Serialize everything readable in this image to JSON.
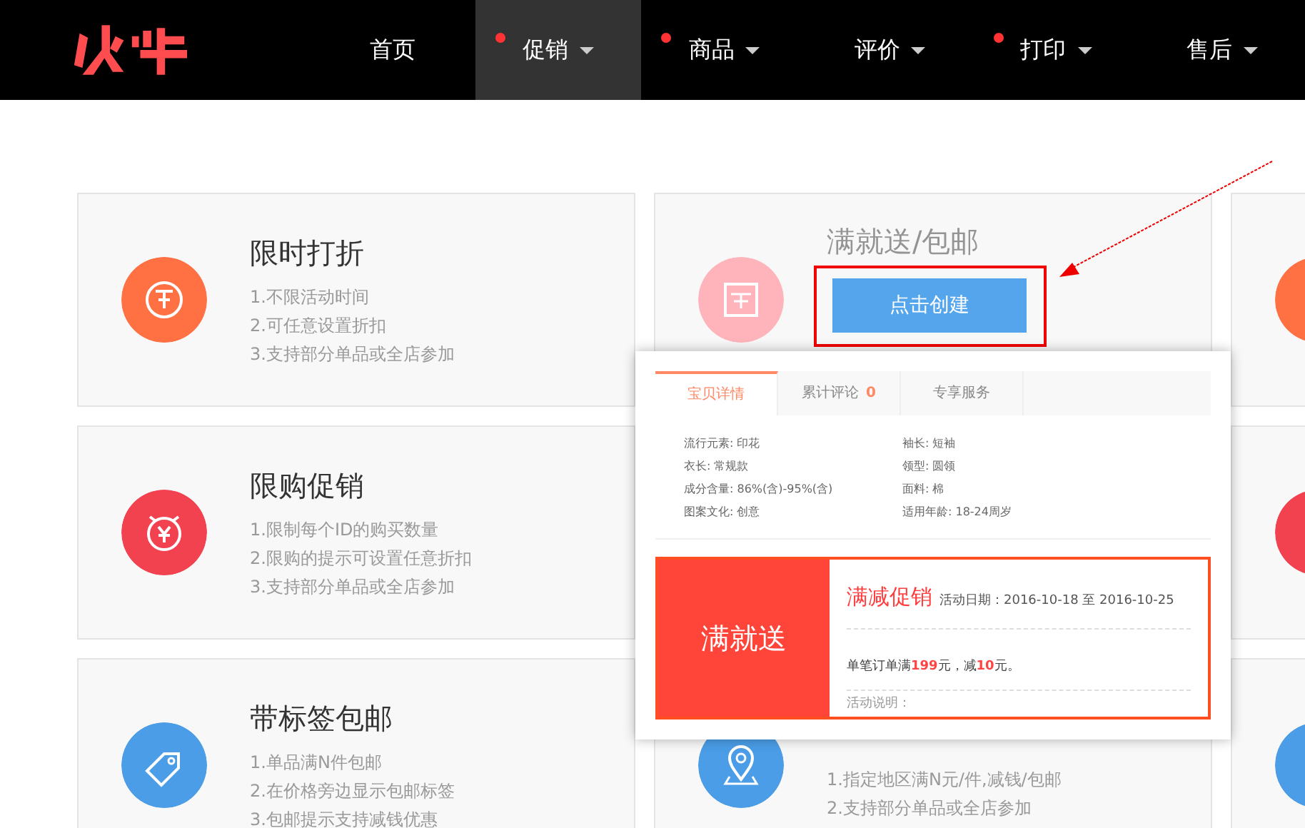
{
  "nav": {
    "items": [
      {
        "label": "首页",
        "selected": false,
        "dot": false,
        "dropdown": false
      },
      {
        "label": "促销",
        "selected": true,
        "dot": true,
        "dropdown": true
      },
      {
        "label": "商品",
        "selected": false,
        "dot": true,
        "dropdown": true
      },
      {
        "label": "评价",
        "selected": false,
        "dot": false,
        "dropdown": true
      },
      {
        "label": "打印",
        "selected": false,
        "dot": true,
        "dropdown": true
      },
      {
        "label": "售后",
        "selected": false,
        "dot": false,
        "dropdown": true
      }
    ]
  },
  "cards": [
    {
      "kind": "discount",
      "color": "#ff7043",
      "title": "限时打折",
      "lines": [
        "1.不限活动时间",
        "2.可任意设置折扣",
        "3.支持部分单品或全店参加"
      ]
    },
    {
      "kind": "full",
      "color": "#ffb3ba",
      "title": "满就送/包邮",
      "button": "点击创建"
    },
    {
      "kind": "edge",
      "color": "#ff7043"
    },
    {
      "kind": "limit",
      "color": "#f2414f",
      "title": "限购促销",
      "lines": [
        "1.限制每个ID的购买数量",
        "2.限购的提示可设置任意折扣",
        "3.支持部分单品或全店参加"
      ]
    },
    {
      "kind": "blank"
    },
    {
      "kind": "edge",
      "color": "#f2414f"
    },
    {
      "kind": "tag",
      "color": "#4a9de6",
      "title": "带标签包邮",
      "lines": [
        "1.单品满N件包邮",
        "2.在价格旁边显示包邮标签",
        "3.包邮提示支持减钱优惠"
      ]
    },
    {
      "kind": "location",
      "color": "#4a9de6",
      "lines": [
        "1.指定地区满N元/件,减钱/包邮",
        "2.支持部分单品或全店参加"
      ]
    },
    {
      "kind": "edge",
      "color": "#4a9de6"
    }
  ],
  "popup": {
    "tabs": [
      {
        "label": "宝贝详情",
        "selected": true
      },
      {
        "label": "累计评论",
        "count": "0",
        "selected": false
      },
      {
        "label": "专享服务",
        "selected": false
      }
    ],
    "specs": [
      "流行元素: 印花",
      "袖长: 短袖",
      "衣长: 常规款",
      "领型: 圆领",
      "成分含量: 86%(含)-95%(含)",
      "面料: 棉",
      "图案文化: 创意",
      "适用年龄: 18-24周岁"
    ],
    "promo": {
      "badge": "满就送",
      "title": "满减促销",
      "date": "活动日期：2016-10-18 至 2016-10-25",
      "rule": "单笔订单满**199**元，减**10**元。",
      "note": "活动说明："
    }
  }
}
